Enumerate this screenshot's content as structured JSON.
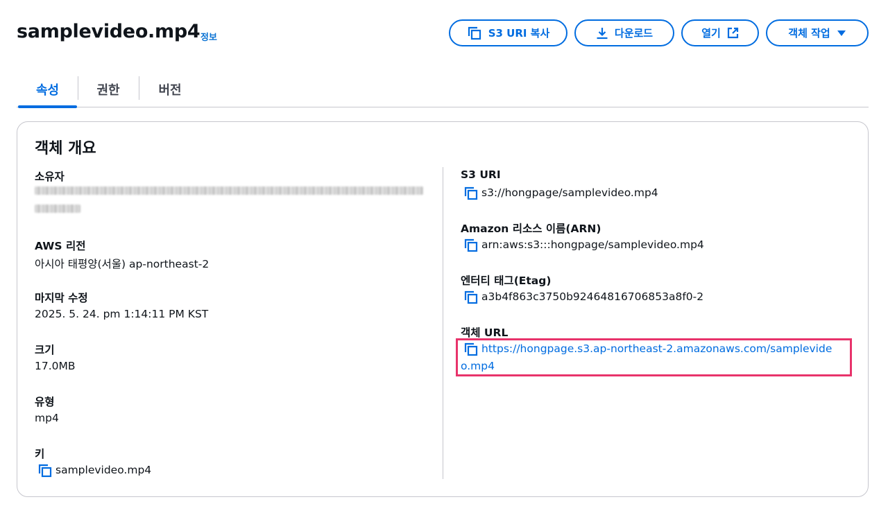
{
  "header": {
    "title": "samplevideo.mp4",
    "info_link": "정보",
    "buttons": {
      "copy_s3_uri": "S3 URI 복사",
      "download": "다운로드",
      "open": "열기",
      "object_actions": "객체 작업"
    }
  },
  "tabs": [
    {
      "label": "속성",
      "active": true
    },
    {
      "label": "권한",
      "active": false
    },
    {
      "label": "버전",
      "active": false
    }
  ],
  "overview": {
    "title": "객체 개요",
    "left": {
      "owner": {
        "label": "소유자",
        "value_redacted": true
      },
      "region": {
        "label": "AWS 리전",
        "value": "아시아 태평양(서울) ap-northeast-2"
      },
      "last_modified": {
        "label": "마지막 수정",
        "value": "2025. 5. 24. pm 1:14:11 PM KST"
      },
      "size": {
        "label": "크기",
        "value": "17.0MB"
      },
      "type": {
        "label": "유형",
        "value": "mp4"
      },
      "key": {
        "label": "키",
        "value": "samplevideo.mp4"
      }
    },
    "right": {
      "s3_uri": {
        "label": "S3 URI",
        "value": "s3://hongpage/samplevideo.mp4"
      },
      "arn": {
        "label": "Amazon 리소스 이름(ARN)",
        "value": "arn:aws:s3:::hongpage/samplevideo.mp4"
      },
      "etag": {
        "label": "엔터티 태그(Etag)",
        "value": "a3b4f863c3750b92464816706853a8f0-2"
      },
      "object_url": {
        "label": "객체 URL",
        "value_line1": "https://hongpage.s3.ap-northeast-2.amazonaws.com/samplevide",
        "value_line2": "o.mp4"
      }
    }
  },
  "colors": {
    "accent": "#006ce0",
    "highlight": "#e8336b",
    "border": "#c6c6cd",
    "text": "#0f141a"
  },
  "icons": [
    "copy-icon",
    "download-icon",
    "external-link-icon",
    "caret-down-icon"
  ]
}
